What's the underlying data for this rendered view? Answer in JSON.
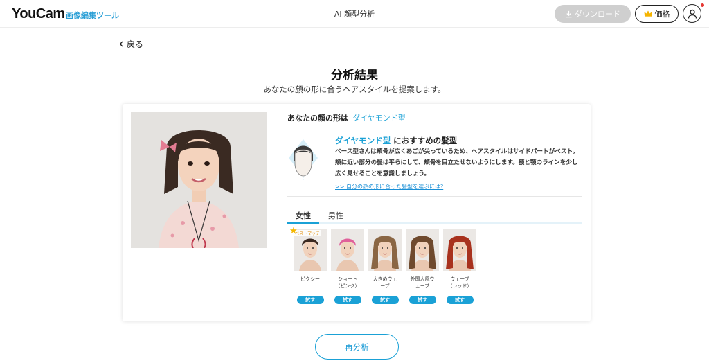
{
  "header": {
    "logo": "YouCam",
    "logo_sub": "画像編集ツール",
    "title": "AI 顔型分析",
    "download_label": "ダウンロード",
    "price_label": "価格"
  },
  "back_label": "戻る",
  "result": {
    "title": "分析結果",
    "subtitle": "あなたの顔の形に合うヘアスタイルを提案します。"
  },
  "analysis": {
    "face_shape_label": "あなたの顔の形は",
    "face_shape_value": "ダイヤモンド型",
    "rec_highlight": "ダイヤモンド型",
    "rec_suffix": "におすすめの髪型",
    "description": "ベース型さんは頬骨が広くあごが尖っているため、ヘアスタイルはサイドパートがベスト。頬に近い部分の髪は平らにして、頬骨を目立たせないようにします。額と顎のラインを少し広く見せることを意識しましょう。",
    "link_text": ">> 自分の顔の形に合った髪型を選ぶには?"
  },
  "tabs": {
    "female": "女性",
    "male": "男性",
    "active": "female"
  },
  "hairstyles": [
    {
      "name_line1": "ピクシー",
      "name_line2": "",
      "try_label": "試す",
      "hair_color": "#3b2a22",
      "best": true
    },
    {
      "name_line1": "ショート",
      "name_line2": "（ピンク）",
      "try_label": "試す",
      "hair_color": "#e0609a",
      "best": false
    },
    {
      "name_line1": "大きめウェ",
      "name_line2": "ーブ",
      "try_label": "試す",
      "hair_color": "#8a6644",
      "best": false
    },
    {
      "name_line1": "外国人風ウ",
      "name_line2": "ェーブ",
      "try_label": "試す",
      "hair_color": "#6f4a2e",
      "best": false
    },
    {
      "name_line1": "ウェーブ",
      "name_line2": "（レッド）",
      "try_label": "試す",
      "hair_color": "#a8321e",
      "best": false
    }
  ],
  "best_match_label": "ベストマッチ",
  "retry_label": "再分析",
  "colors": {
    "accent": "#1aa1d6",
    "download_bg": "#cfcfcf"
  }
}
